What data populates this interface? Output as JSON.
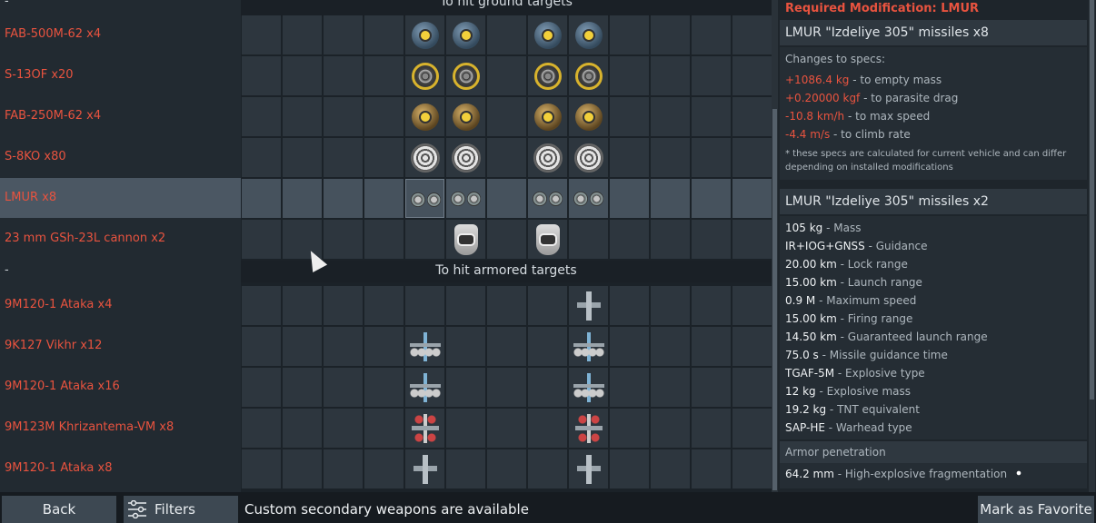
{
  "sections": {
    "ground": {
      "dash": "-",
      "title": "To hit ground targets"
    },
    "armored": {
      "dash": "-",
      "title": "To hit armored targets"
    }
  },
  "rows": [
    {
      "label": "FAB-500M-62 x4",
      "icon": "bomb-blue-icon"
    },
    {
      "label": "S-13OF x20",
      "icon": "rocket-pod-icon"
    },
    {
      "label": "FAB-250M-62 x4",
      "icon": "bomb-gold-icon"
    },
    {
      "label": "S-8KO x80",
      "icon": "rocket-pod-large-icon"
    },
    {
      "label": "LMUR x8",
      "icon": "lmur-missile-icon",
      "selected": true
    },
    {
      "label": "23 mm GSh-23L cannon x2",
      "icon": "gun-pod-icon"
    },
    {
      "label": "9M120-1 Ataka x4",
      "icon": "atgm-icon"
    },
    {
      "label": "9K127 Vikhr x12",
      "icon": "atgm-multi-icon"
    },
    {
      "label": "9M120-1 Ataka x16",
      "icon": "atgm-multi-icon"
    },
    {
      "label": "9M123M Khrizantema-VM x8",
      "icon": "atgm-red-icon"
    },
    {
      "label": "9M120-1 Ataka x8",
      "icon": "atgm-icon"
    }
  ],
  "right_panel": {
    "required_mod": "Required Modification: LMUR",
    "title1": "LMUR \"Izdeliye 305\" missiles x8",
    "changes_label": "Changes to specs:",
    "changes": [
      {
        "value": "+1086.4 kg",
        "desc": " - to empty mass"
      },
      {
        "value": "+0.20000 kgf",
        "desc": " - to parasite drag"
      },
      {
        "value": "-10.8 km/h",
        "desc": " - to max speed"
      },
      {
        "value": "-4.4 m/s",
        "desc": " - to climb rate"
      }
    ],
    "note": "* these specs are calculated for current vehicle and can differ depending on installed modifications",
    "title2": "LMUR \"Izdeliye 305\" missiles x2",
    "specs": [
      {
        "value": "105 kg",
        "desc": " - Mass"
      },
      {
        "value": "IR+IOG+GNSS",
        "desc": " - Guidance"
      },
      {
        "value": "20.00 km",
        "desc": " - Lock range"
      },
      {
        "value": "15.00 km",
        "desc": " - Launch range"
      },
      {
        "value": "0.9 M",
        "desc": " - Maximum speed"
      },
      {
        "value": "15.00 km",
        "desc": " - Firing range"
      },
      {
        "value": "14.50 km",
        "desc": " - Guaranteed launch range"
      },
      {
        "value": "75.0 s",
        "desc": " - Missile guidance time"
      },
      {
        "value": "TGAF-5M",
        "desc": " - Explosive type"
      },
      {
        "value": "12 kg",
        "desc": " - Explosive mass"
      },
      {
        "value": "19.2 kg",
        "desc": " - TNT equivalent"
      },
      {
        "value": "SAP-HE",
        "desc": " - Warhead type"
      }
    ],
    "armor_label": "Armor penetration",
    "armor": {
      "value": "64.2 mm",
      "desc": " - High-explosive fragmentation"
    }
  },
  "bottom": {
    "back": "Back",
    "filters": "Filters",
    "status": "Custom secondary weapons are available",
    "favorite": "Mark as Favorite"
  },
  "colors": {
    "accent_red": "#e8533f",
    "selected_row": "#4b5763"
  }
}
